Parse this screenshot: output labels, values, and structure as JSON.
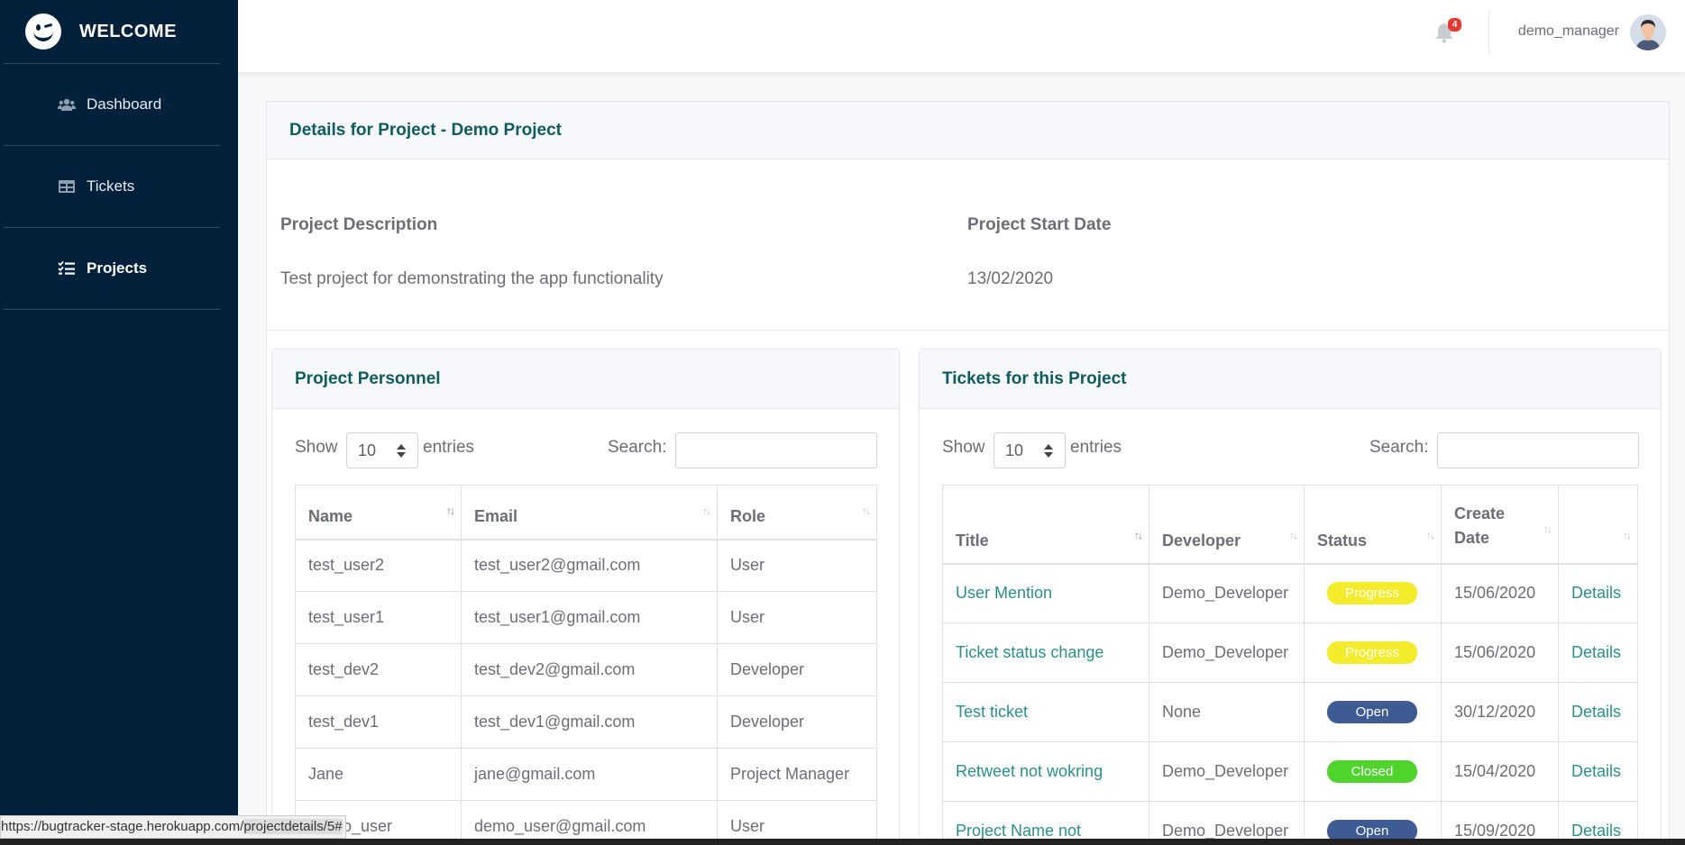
{
  "brand": {
    "title": "WELCOME"
  },
  "sidebar": {
    "items": [
      {
        "label": "Dashboard",
        "icon": "users-icon"
      },
      {
        "label": "Tickets",
        "icon": "table-icon"
      },
      {
        "label": "Projects",
        "icon": "list-icon",
        "active": true
      }
    ]
  },
  "header": {
    "notification_count": "4",
    "username": "demo_manager"
  },
  "project": {
    "title": "Details for Project - Demo Project",
    "description_label": "Project Description",
    "description": "Test project for demonstrating the app functionality",
    "start_date_label": "Project Start Date",
    "start_date": "13/02/2020"
  },
  "personnel": {
    "title": "Project Personnel",
    "show_label": "Show",
    "entries_value": "10",
    "entries_label": "entries",
    "search_label": "Search:",
    "search_value": "",
    "columns": [
      "Name",
      "Email",
      "Role"
    ],
    "rows": [
      [
        "test_user2",
        "test_user2@gmail.com",
        "User"
      ],
      [
        "test_user1",
        "test_user1@gmail.com",
        "User"
      ],
      [
        "test_dev2",
        "test_dev2@gmail.com",
        "Developer"
      ],
      [
        "test_dev1",
        "test_dev1@gmail.com",
        "Developer"
      ],
      [
        "Jane",
        "jane@gmail.com",
        "Project Manager"
      ],
      [
        "Demo_user",
        "demo_user@gmail.com",
        "User"
      ]
    ]
  },
  "tickets": {
    "title": "Tickets for this Project",
    "show_label": "Show",
    "entries_value": "10",
    "entries_label": "entries",
    "search_label": "Search:",
    "search_value": "",
    "columns": [
      "Title",
      "Developer",
      "Status",
      "Create Date",
      ""
    ],
    "rows": [
      {
        "title": "User Mention",
        "developer": "Demo_Developer",
        "status": "Progress",
        "date": "15/06/2020",
        "action": "Details"
      },
      {
        "title": "Ticket status change",
        "developer": "Demo_Developer",
        "status": "Progress",
        "date": "15/06/2020",
        "action": "Details"
      },
      {
        "title": "Test ticket",
        "developer": "None",
        "status": "Open",
        "date": "30/12/2020",
        "action": "Details"
      },
      {
        "title": "Retweet not wokring",
        "developer": "Demo_Developer",
        "status": "Closed",
        "date": "15/04/2020",
        "action": "Details"
      },
      {
        "title": "Project Name not",
        "developer": "Demo_Developer",
        "status": "Open",
        "date": "15/09/2020",
        "action": "Details"
      }
    ],
    "status_colors": {
      "Progress": "#f4ec2a",
      "Open": "#3e5b93",
      "Closed": "#4fd42e"
    }
  },
  "statusbar": {
    "url_prefix": "https://bugtracker-stage.herokuapp.com/",
    "url_highlight": "projectdetails/5#"
  }
}
